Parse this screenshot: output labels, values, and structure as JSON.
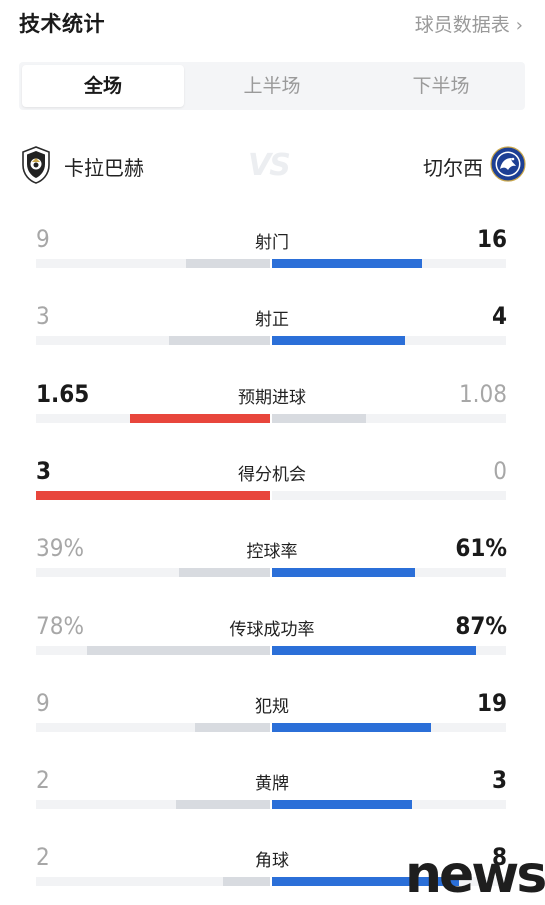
{
  "header": {
    "title": "技术统计",
    "link": "球员数据表"
  },
  "tabs": [
    {
      "label": "全场",
      "active": true
    },
    {
      "label": "上半场",
      "active": false
    },
    {
      "label": "下半场",
      "active": false
    }
  ],
  "teams": {
    "home": {
      "name": "卡拉巴赫"
    },
    "vs": "VS",
    "away": {
      "name": "切尔西"
    }
  },
  "colors": {
    "blue": "#2b6fd8",
    "red": "#e8463c",
    "grey": "#d8dbe0",
    "track": "#f2f3f5"
  },
  "stats": [
    {
      "label": "射门",
      "home": "9",
      "away": "16",
      "home_fraction": 0.36,
      "away_fraction": 0.64,
      "home_bar": "grey",
      "away_bar": "blue",
      "winner": "away"
    },
    {
      "label": "射正",
      "home": "3",
      "away": "4",
      "home_fraction": 0.43,
      "away_fraction": 0.57,
      "home_bar": "grey",
      "away_bar": "blue",
      "winner": "away"
    },
    {
      "label": "预期进球",
      "home": "1.65",
      "away": "1.08",
      "home_fraction": 0.6,
      "away_fraction": 0.4,
      "home_bar": "red",
      "away_bar": "grey",
      "winner": "home"
    },
    {
      "label": "得分机会",
      "home": "3",
      "away": "0",
      "home_fraction": 1.0,
      "away_fraction": 0.0,
      "home_bar": "red",
      "away_bar": "grey",
      "winner": "home"
    },
    {
      "label": "控球率",
      "home": "39%",
      "away": "61%",
      "home_fraction": 0.39,
      "away_fraction": 0.61,
      "home_bar": "grey",
      "away_bar": "blue",
      "winner": "away"
    },
    {
      "label": "传球成功率",
      "home": "78%",
      "away": "87%",
      "home_fraction": 0.78,
      "away_fraction": 0.87,
      "home_bar": "grey",
      "away_bar": "blue",
      "winner": "away"
    },
    {
      "label": "犯规",
      "home": "9",
      "away": "19",
      "home_fraction": 0.32,
      "away_fraction": 0.68,
      "home_bar": "grey",
      "away_bar": "blue",
      "winner": "away"
    },
    {
      "label": "黄牌",
      "home": "2",
      "away": "3",
      "home_fraction": 0.4,
      "away_fraction": 0.6,
      "home_bar": "grey",
      "away_bar": "blue",
      "winner": "away"
    },
    {
      "label": "角球",
      "home": "2",
      "away": "8",
      "home_fraction": 0.2,
      "away_fraction": 0.8,
      "home_bar": "grey",
      "away_bar": "blue",
      "winner": "away"
    }
  ],
  "watermark": "news"
}
